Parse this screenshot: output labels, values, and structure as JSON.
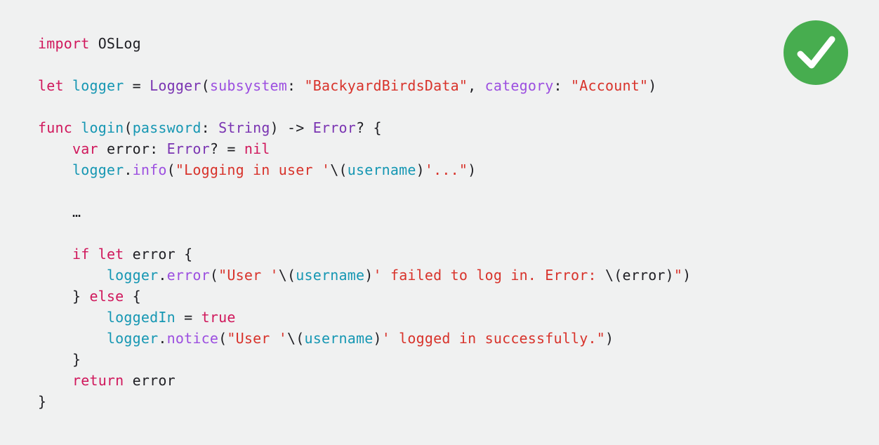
{
  "check_badge": {
    "icon": "checkmark-icon",
    "color": "#47ad4f"
  },
  "colors": {
    "keyword": "#d0185c",
    "identifier": "#1697b3",
    "type": "#7a34b2",
    "method": "#9c4fe0",
    "string": "#d8332b",
    "plain": "#1f1f24",
    "background": "#f0f1f1"
  },
  "code": {
    "lines": [
      [
        {
          "c": "kw",
          "t": "import"
        },
        {
          "c": "pl",
          "t": " OSLog"
        }
      ],
      [],
      [
        {
          "c": "kw",
          "t": "let"
        },
        {
          "c": "pl",
          "t": " "
        },
        {
          "c": "id",
          "t": "logger"
        },
        {
          "c": "pl",
          "t": " = "
        },
        {
          "c": "ty",
          "t": "Logger"
        },
        {
          "c": "pl",
          "t": "("
        },
        {
          "c": "mt",
          "t": "subsystem"
        },
        {
          "c": "pl",
          "t": ": "
        },
        {
          "c": "str",
          "t": "\"BackyardBirdsData\""
        },
        {
          "c": "pl",
          "t": ", "
        },
        {
          "c": "mt",
          "t": "category"
        },
        {
          "c": "pl",
          "t": ": "
        },
        {
          "c": "str",
          "t": "\"Account\""
        },
        {
          "c": "pl",
          "t": ")"
        }
      ],
      [],
      [
        {
          "c": "kw",
          "t": "func"
        },
        {
          "c": "pl",
          "t": " "
        },
        {
          "c": "id",
          "t": "login"
        },
        {
          "c": "pl",
          "t": "("
        },
        {
          "c": "id",
          "t": "password"
        },
        {
          "c": "pl",
          "t": ": "
        },
        {
          "c": "ty",
          "t": "String"
        },
        {
          "c": "pl",
          "t": ") -> "
        },
        {
          "c": "ty",
          "t": "Error"
        },
        {
          "c": "pl",
          "t": "? {"
        }
      ],
      [
        {
          "c": "pl",
          "t": "    "
        },
        {
          "c": "kw",
          "t": "var"
        },
        {
          "c": "pl",
          "t": " error: "
        },
        {
          "c": "ty",
          "t": "Error"
        },
        {
          "c": "pl",
          "t": "? = "
        },
        {
          "c": "kw",
          "t": "nil"
        }
      ],
      [
        {
          "c": "pl",
          "t": "    "
        },
        {
          "c": "id",
          "t": "logger"
        },
        {
          "c": "pl",
          "t": "."
        },
        {
          "c": "mt",
          "t": "info"
        },
        {
          "c": "pl",
          "t": "("
        },
        {
          "c": "str",
          "t": "\"Logging in user '"
        },
        {
          "c": "pl",
          "t": "\\("
        },
        {
          "c": "id",
          "t": "username"
        },
        {
          "c": "pl",
          "t": ")"
        },
        {
          "c": "str",
          "t": "'...\""
        },
        {
          "c": "pl",
          "t": ")"
        }
      ],
      [],
      [
        {
          "c": "pl",
          "t": "    …"
        }
      ],
      [],
      [
        {
          "c": "pl",
          "t": "    "
        },
        {
          "c": "kw",
          "t": "if"
        },
        {
          "c": "pl",
          "t": " "
        },
        {
          "c": "kw",
          "t": "let"
        },
        {
          "c": "pl",
          "t": " error {"
        }
      ],
      [
        {
          "c": "pl",
          "t": "        "
        },
        {
          "c": "id",
          "t": "logger"
        },
        {
          "c": "pl",
          "t": "."
        },
        {
          "c": "mt",
          "t": "error"
        },
        {
          "c": "pl",
          "t": "("
        },
        {
          "c": "str",
          "t": "\"User '"
        },
        {
          "c": "pl",
          "t": "\\("
        },
        {
          "c": "id",
          "t": "username"
        },
        {
          "c": "pl",
          "t": ")"
        },
        {
          "c": "str",
          "t": "' failed to log in. Error: "
        },
        {
          "c": "pl",
          "t": "\\(error)"
        },
        {
          "c": "str",
          "t": "\""
        },
        {
          "c": "pl",
          "t": ")"
        }
      ],
      [
        {
          "c": "pl",
          "t": "    } "
        },
        {
          "c": "kw",
          "t": "else"
        },
        {
          "c": "pl",
          "t": " {"
        }
      ],
      [
        {
          "c": "pl",
          "t": "        "
        },
        {
          "c": "id",
          "t": "loggedIn"
        },
        {
          "c": "pl",
          "t": " = "
        },
        {
          "c": "kw",
          "t": "true"
        }
      ],
      [
        {
          "c": "pl",
          "t": "        "
        },
        {
          "c": "id",
          "t": "logger"
        },
        {
          "c": "pl",
          "t": "."
        },
        {
          "c": "mt",
          "t": "notice"
        },
        {
          "c": "pl",
          "t": "("
        },
        {
          "c": "str",
          "t": "\"User '"
        },
        {
          "c": "pl",
          "t": "\\("
        },
        {
          "c": "id",
          "t": "username"
        },
        {
          "c": "pl",
          "t": ")"
        },
        {
          "c": "str",
          "t": "' logged in successfully.\""
        },
        {
          "c": "pl",
          "t": ")"
        }
      ],
      [
        {
          "c": "pl",
          "t": "    }"
        }
      ],
      [
        {
          "c": "pl",
          "t": "    "
        },
        {
          "c": "kw",
          "t": "return"
        },
        {
          "c": "pl",
          "t": " error"
        }
      ],
      [
        {
          "c": "pl",
          "t": "}"
        }
      ]
    ]
  }
}
